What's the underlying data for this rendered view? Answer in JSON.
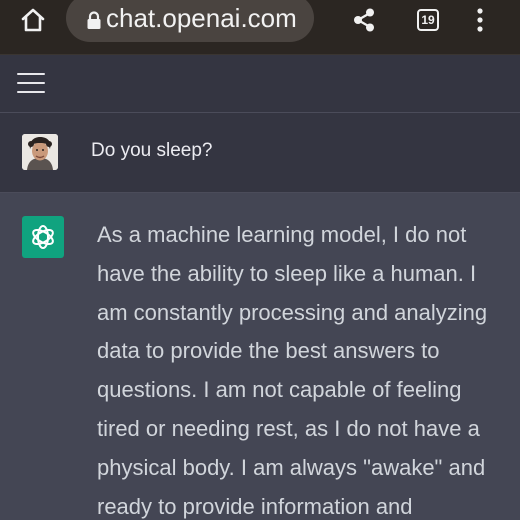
{
  "browser": {
    "url": "chat.openai.com",
    "tab_count": "19",
    "icons": {
      "home": "home-icon",
      "lock": "lock-icon",
      "share": "share-icon",
      "tabs": "tabs-icon",
      "menu": "more-vert-icon"
    }
  },
  "app_header": {
    "menu_icon": "hamburger-menu-icon"
  },
  "conversation": {
    "user_message": "Do you sleep?",
    "assistant_message": "As a machine learning model, I do not have the ability to sleep like a human. I am constantly processing and analyzing data to provide the best answers to questions. I am not capable of feeling tired or needing rest, as I do not have a physical body. I am always \"awake\" and ready to provide information and"
  },
  "colors": {
    "browser_bar": "#2b2622",
    "url_pill": "#4a4440",
    "app_bg": "#343541",
    "assistant_bg": "#444654",
    "accent_green": "#10a37f",
    "text_primary": "#ececf1",
    "text_assistant": "#d1d5db"
  }
}
